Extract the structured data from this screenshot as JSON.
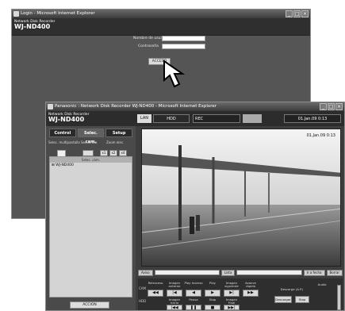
{
  "login_window": {
    "title": "Login - Microsoft Internet Explorer",
    "product_small": "Network Disk Recorder",
    "model": "WJ-ND400",
    "user_label": "Nombre de usuario",
    "password_label": "Contraseña",
    "login_button": "ACCESO"
  },
  "app_window": {
    "title": "Panasonic : Network Disk Recorder WJ-ND400 - Microsoft Internet Explorer",
    "product_small": "Network Disk Recorder",
    "model": "WJ-ND400",
    "status": {
      "lan": "LAN",
      "hdd": "HDD",
      "rec": "REC",
      "datetime": "01.Jan.09 0:13"
    },
    "tabs": [
      "Control",
      "Selec. cam.",
      "Setup"
    ],
    "controls": {
      "multiscreen_label": "Selec. multipantalla",
      "sequence_label": "Secuencia",
      "zoom_label": "Zoom elec.",
      "zoom_buttons": [
        "x1",
        "x2",
        "x4"
      ]
    },
    "camera_list": {
      "header": "Selec. cám.",
      "items": [
        "WJ-ND400"
      ]
    },
    "action_button": "ACCION",
    "video": {
      "datetime": "01.Jan.09 0:13"
    },
    "bottom_bar": {
      "left": "Aviso",
      "mid": "Lista",
      "right1": "Ir a fecha",
      "right2": "Borrar"
    },
    "playback": {
      "labels": [
        "Retroceso",
        "Imagen anterior",
        "Play Inverso",
        "Play",
        "Imagen siguiente",
        "Avance rápido"
      ],
      "labels2": [
        "Imagen Inicio",
        "Pausa",
        "Stop",
        "Imagen Final"
      ],
      "cam_label": "CAM",
      "hdd_label": "HDD",
      "download_label": "Descarga (A.P.)",
      "download_button": "Descargar",
      "download_button2": "Stop",
      "audio_label": "Audio"
    }
  }
}
